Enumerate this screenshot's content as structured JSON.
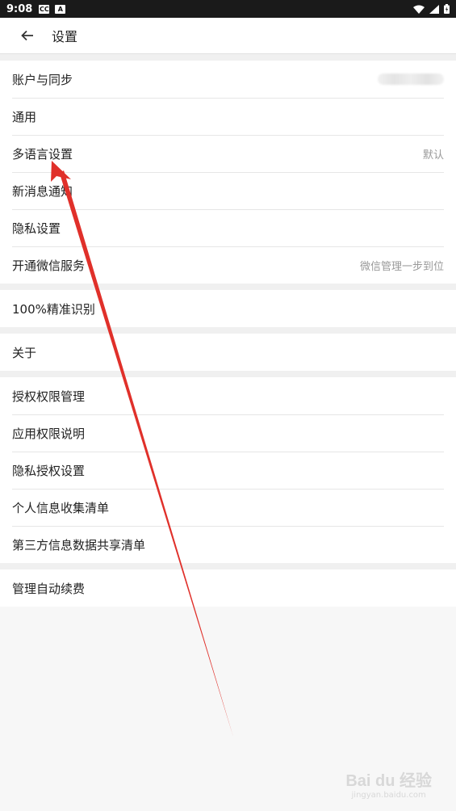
{
  "status_bar": {
    "time": "9:08",
    "badges": [
      "CC",
      "A"
    ],
    "icons": [
      "wifi-icon",
      "signal-icon",
      "battery-icon"
    ]
  },
  "header": {
    "back_icon": "arrow-left-icon",
    "title": "设置"
  },
  "groups": [
    {
      "items": [
        {
          "label": "账户与同步",
          "value": ""
        },
        {
          "label": "通用",
          "value": ""
        },
        {
          "label": "多语言设置",
          "value": "默认"
        },
        {
          "label": "新消息通知",
          "value": ""
        },
        {
          "label": "隐私设置",
          "value": ""
        },
        {
          "label": "开通微信服务",
          "value": "微信管理一步到位"
        }
      ]
    },
    {
      "items": [
        {
          "label": "100%精准识别",
          "value": ""
        }
      ]
    },
    {
      "items": [
        {
          "label": "关于",
          "value": ""
        }
      ]
    },
    {
      "items": [
        {
          "label": "授权权限管理",
          "value": ""
        },
        {
          "label": "应用权限说明",
          "value": ""
        },
        {
          "label": "隐私授权设置",
          "value": ""
        },
        {
          "label": "个人信息收集清单",
          "value": ""
        },
        {
          "label": "第三方信息数据共享清单",
          "value": ""
        }
      ]
    },
    {
      "items": [
        {
          "label": "管理自动续费",
          "value": ""
        }
      ]
    }
  ],
  "annotation": {
    "color": "#e0302a"
  },
  "watermark": {
    "brand": "Bai du 经验",
    "sub": "jingyan.baidu.com"
  }
}
